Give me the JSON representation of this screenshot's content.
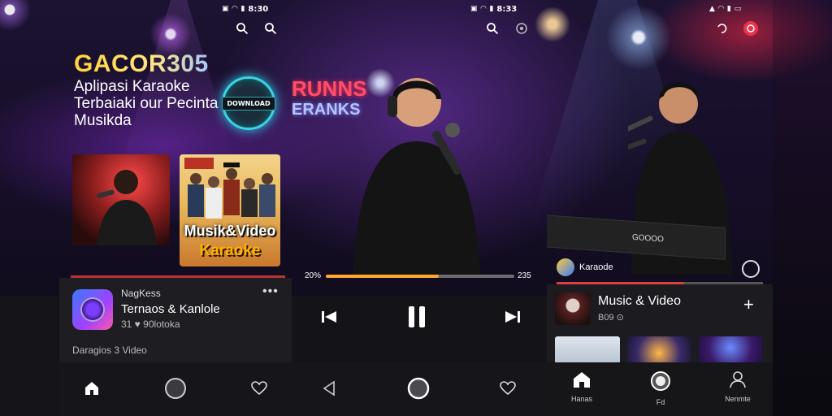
{
  "screen1": {
    "status": {
      "time": "8:30"
    },
    "brand": "GACOR305",
    "tagline": [
      "Aplipasi Karaoke",
      "Terbaiaki our Pecinta",
      "Musikda"
    ],
    "cta_label": "DOWNLOAD",
    "thumbnail_caption": [
      "Musik&Video",
      "Karaoke"
    ],
    "card": {
      "subtitle": "NagKess",
      "title": "Ternaos & Kanlole",
      "meta": "31 ♥ 90lotoka"
    },
    "footer": "Daragios 3 Video"
  },
  "screen2": {
    "status": {
      "time": "8:33"
    },
    "neon_sign": [
      "RUNNS",
      "ERANKS"
    ],
    "time_elapsed": "20%",
    "time_total": "235",
    "progress": 0.6
  },
  "screen3": {
    "keyboard_label": "GOOOO",
    "now_playing": "Karaode",
    "progress": 0.62,
    "card": {
      "title": "Music & Video",
      "meta": "B09 ⊙"
    },
    "nav": [
      {
        "label": "Hanas"
      },
      {
        "label": "Fd"
      },
      {
        "label": "Nenmte"
      }
    ]
  },
  "colors": {
    "brand_gold": "#ffd23a",
    "cta_ring": "#37d5e6",
    "accent_orange": "#ffa733",
    "accent_red": "#d93f3f"
  },
  "icons": [
    "search-icon",
    "home-icon",
    "heart-icon",
    "back-icon",
    "pause-icon",
    "skip-back-icon",
    "skip-forward-icon",
    "plus-icon",
    "user-icon",
    "more-icon"
  ]
}
